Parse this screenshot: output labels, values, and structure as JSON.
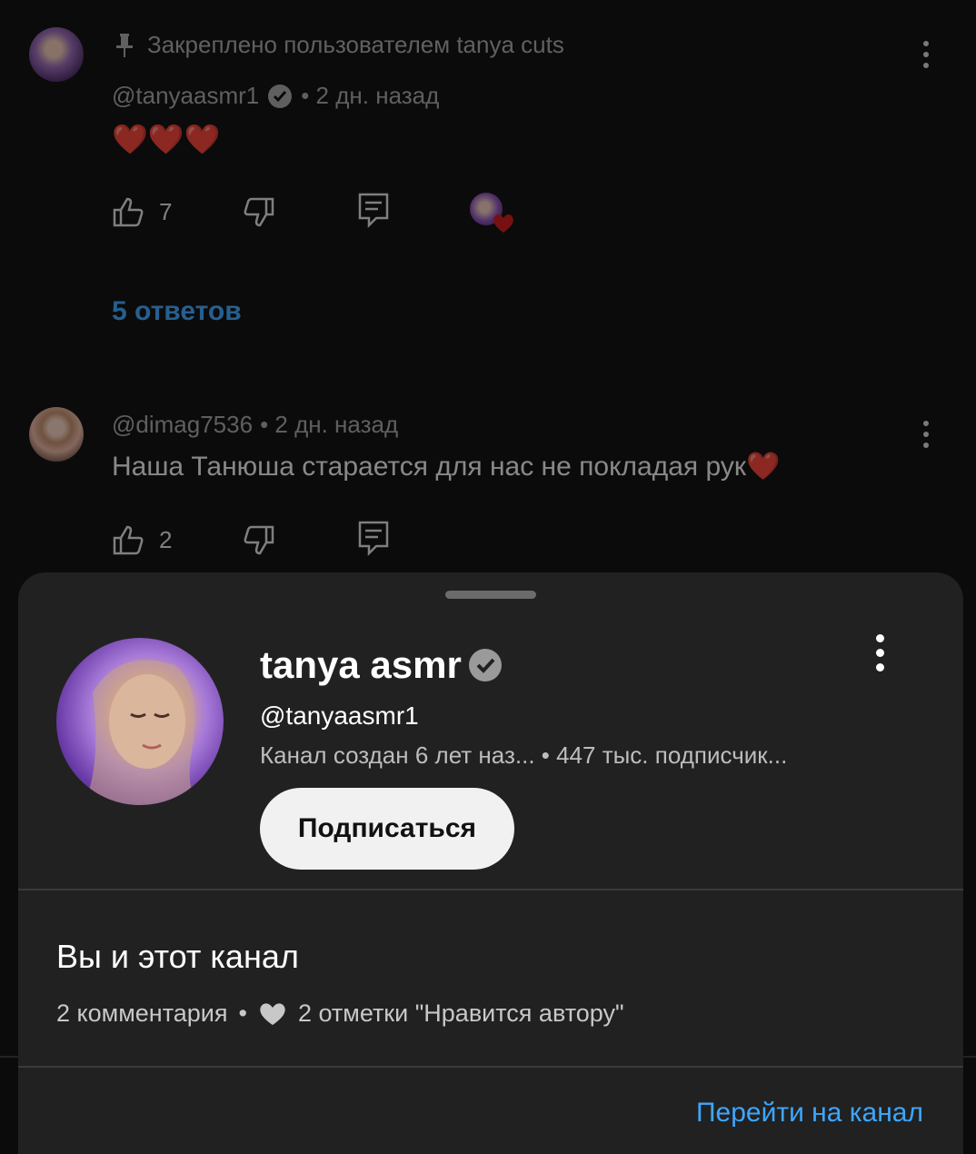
{
  "comments": [
    {
      "pinned_text": "Закреплено пользователем tanya cuts",
      "author": "@tanyaasmr1",
      "verified": true,
      "time": "• 2 дн. назад",
      "text": "❤️❤️❤️",
      "likes": "7",
      "replies_label": "5 ответов"
    },
    {
      "author": "@dimag7536",
      "time": "• 2 дн. назад",
      "text": "Наша Танюша старается для нас не покладая рук❤️",
      "likes": "2"
    }
  ],
  "sheet": {
    "channel_name": "tanya asmr",
    "handle": "@tanyaasmr1",
    "info": "Канал создан 6 лет наз...  • 447 тыс. подписчик...",
    "subscribe_label": "Подписаться",
    "section_title": "Вы и этот канал",
    "comments_stat": "2 комментария",
    "bullet": "•",
    "likes_stat": "2 отметки \"Нравится автору\"",
    "go_to_channel": "Перейти на канал"
  },
  "colors": {
    "accent": "#3ea6ff",
    "sheet_bg": "#212121",
    "page_bg": "#0b0b0b",
    "heart": "#d21919"
  }
}
